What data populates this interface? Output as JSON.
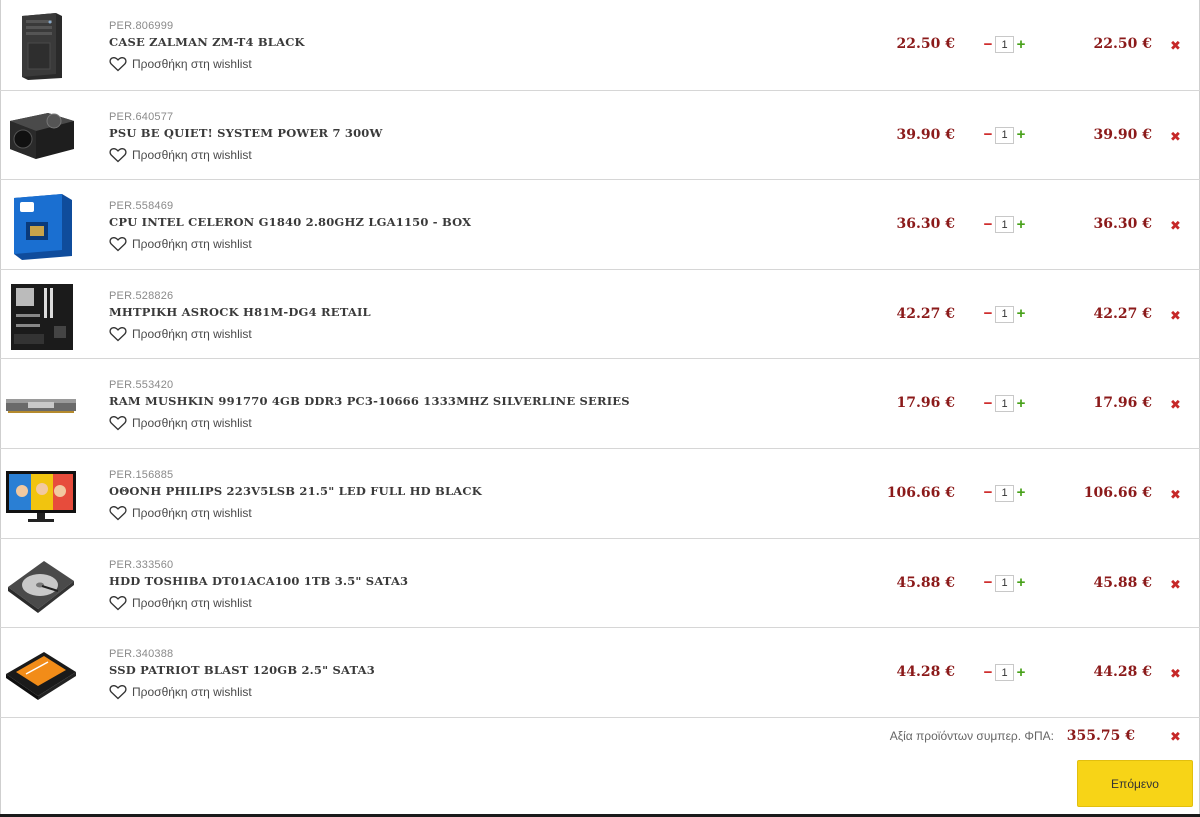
{
  "cart": {
    "items": [
      {
        "sku": "PER.806999",
        "name": "CASE ZALMAN ZM-T4 BLACK",
        "wishlist_label": "Προσθήκη στη wishlist",
        "price": "22.50 €",
        "quantity": "1",
        "total": "22.50 €",
        "image": "pc-case-image"
      },
      {
        "sku": "PER.640577",
        "name": "PSU BE QUIET! SYSTEM POWER 7 300W",
        "wishlist_label": "Προσθήκη στη wishlist",
        "price": "39.90 €",
        "quantity": "1",
        "total": "39.90 €",
        "image": "psu-image"
      },
      {
        "sku": "PER.558469",
        "name": "CPU INTEL CELERON G1840 2.80GHZ LGA1150 - BOX",
        "wishlist_label": "Προσθήκη στη wishlist",
        "price": "36.30 €",
        "quantity": "1",
        "total": "36.30 €",
        "image": "cpu-box-image"
      },
      {
        "sku": "PER.528826",
        "name": "ΜΗΤΡΙΚΗ ASROCK H81M-DG4 RETAIL",
        "wishlist_label": "Προσθήκη στη wishlist",
        "price": "42.27 €",
        "quantity": "1",
        "total": "42.27 €",
        "image": "motherboard-image"
      },
      {
        "sku": "PER.553420",
        "name": "RAM MUSHKIN 991770 4GB DDR3 PC3-10666 1333MHZ SILVERLINE SERIES",
        "wishlist_label": "Προσθήκη στη wishlist",
        "price": "17.96 €",
        "quantity": "1",
        "total": "17.96 €",
        "image": "ram-image"
      },
      {
        "sku": "PER.156885",
        "name": "ΟΘΟΝΗ PHILIPS 223V5LSB 21.5\" LED FULL HD BLACK",
        "wishlist_label": "Προσθήκη στη wishlist",
        "price": "106.66 €",
        "quantity": "1",
        "total": "106.66 €",
        "image": "monitor-image"
      },
      {
        "sku": "PER.333560",
        "name": "HDD TOSHIBA DT01ACA100 1TB 3.5\" SATA3",
        "wishlist_label": "Προσθήκη στη wishlist",
        "price": "45.88 €",
        "quantity": "1",
        "total": "45.88 €",
        "image": "hdd-image"
      },
      {
        "sku": "PER.340388",
        "name": "SSD PATRIOT BLAST 120GB 2.5\" SATA3",
        "wishlist_label": "Προσθήκη στη wishlist",
        "price": "44.28 €",
        "quantity": "1",
        "total": "44.28 €",
        "image": "ssd-image"
      }
    ],
    "icons": {
      "wishlist": "heart-outline-icon",
      "remove": "close-x-icon",
      "minus": "minus-icon",
      "plus": "plus-icon"
    }
  },
  "summary": {
    "label": "Αξία προϊόντων συμπερ. ΦΠΑ:",
    "value": "355.75 €",
    "next_label": "Επόμενο"
  },
  "colors": {
    "price": "#8b1a1a",
    "remove": "#c62828",
    "plus": "#48a11a",
    "minus": "#cc2222",
    "next_button": "#f7d417"
  }
}
